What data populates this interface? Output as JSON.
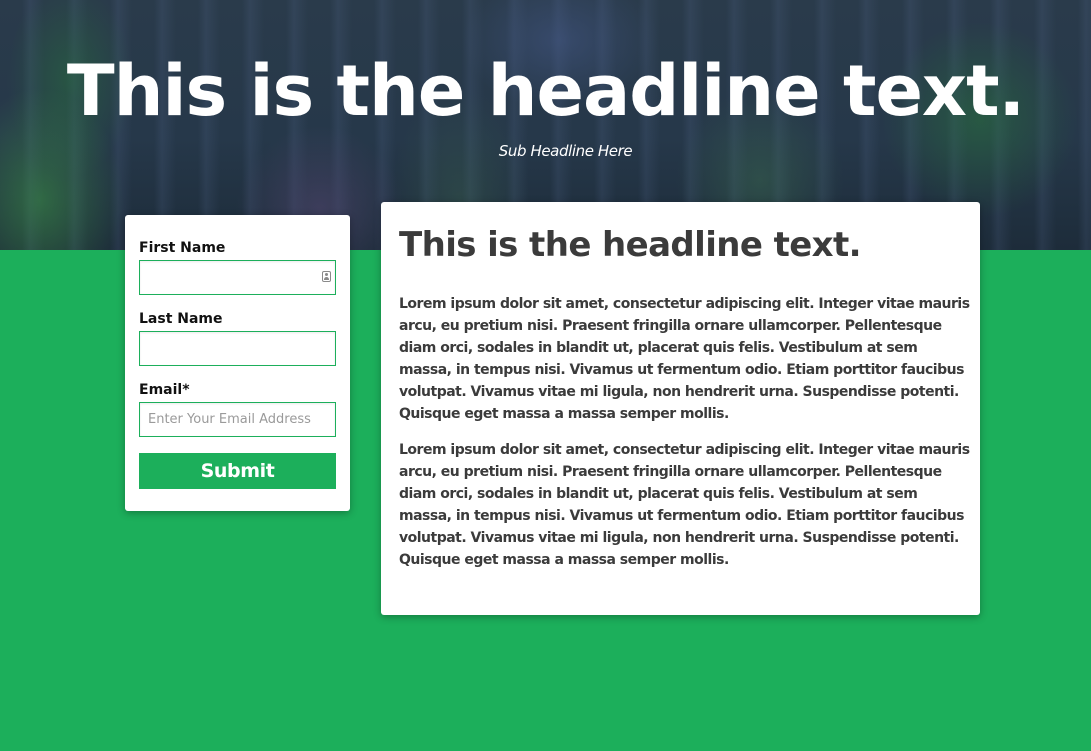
{
  "hero": {
    "title": "This is the headline text.",
    "subtitle": "Sub Headline Here"
  },
  "form": {
    "first_name_label": "First Name",
    "first_name_value": "",
    "last_name_label": "Last Name",
    "last_name_value": "",
    "email_label": "Email*",
    "email_value": "",
    "email_placeholder": "Enter Your Email Address",
    "submit_label": "Submit",
    "autofill_icon": "contact-card-icon"
  },
  "content": {
    "title": "This is the headline text.",
    "paragraphs": [
      "Lorem ipsum dolor sit amet, consectetur adipiscing elit. Integer vitae mauris arcu, eu pretium nisi. Praesent fringilla ornare ullamcorper. Pellentesque diam orci, sodales in blandit ut, placerat quis felis. Vestibulum at sem massa, in tempus nisi. Vivamus ut fermentum odio. Etiam porttitor faucibus volutpat. Vivamus vitae mi ligula, non hendrerit urna. Suspendisse potenti. Quisque eget massa a massa semper mollis.",
      "Lorem ipsum dolor sit amet, consectetur adipiscing elit. Integer vitae mauris arcu, eu pretium nisi. Praesent fringilla ornare ullamcorper. Pellentesque diam orci, sodales in blandit ut, placerat quis felis. Vestibulum at sem massa, in tempus nisi. Vivamus ut fermentum odio. Etiam porttitor faucibus volutpat. Vivamus vitae mi ligula, non hendrerit urna. Suspendisse potenti. Quisque eget massa a massa semper mollis."
    ]
  },
  "colors": {
    "brand_green": "#1caf5b",
    "text_dark": "#3b3b3b",
    "hero_text": "#ffffff"
  }
}
